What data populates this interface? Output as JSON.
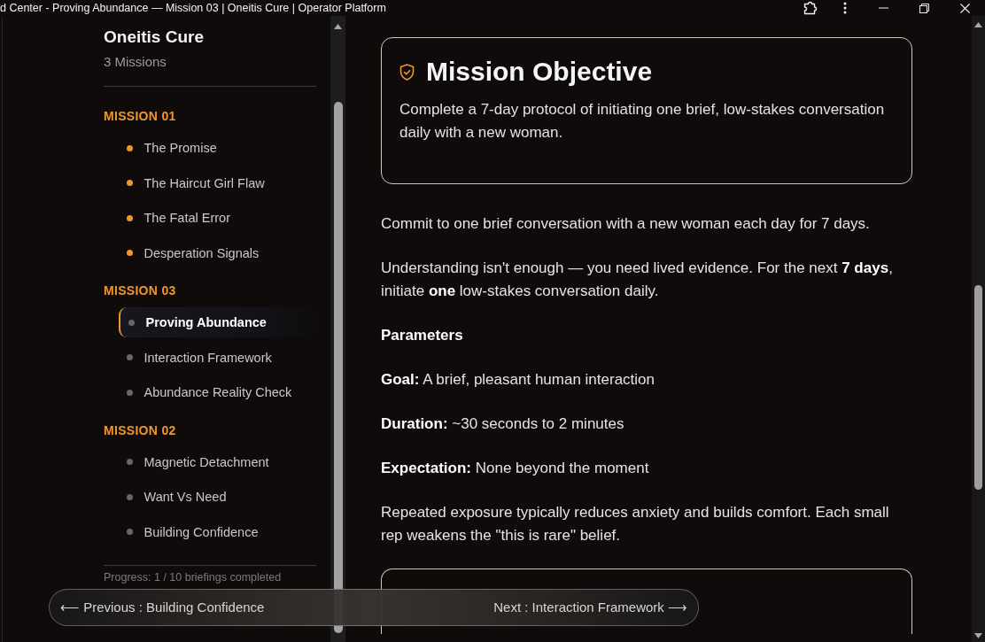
{
  "window": {
    "title": "d Center - Proving Abundance — Mission 03 | Oneitis Cure | Operator Platform"
  },
  "sidebar": {
    "title": "Oneitis Cure",
    "subtitle": "3 Missions",
    "missions": [
      {
        "label": "MISSION 01",
        "lessons": [
          {
            "label": "The Promise",
            "completed": true,
            "selected": false
          },
          {
            "label": "The Haircut Girl Flaw",
            "completed": true,
            "selected": false
          },
          {
            "label": "The Fatal Error",
            "completed": true,
            "selected": false
          },
          {
            "label": "Desperation Signals",
            "completed": true,
            "selected": false
          }
        ]
      },
      {
        "label": "MISSION 03",
        "lessons": [
          {
            "label": "Proving Abundance",
            "completed": false,
            "selected": true
          },
          {
            "label": "Interaction Framework",
            "completed": false,
            "selected": false
          },
          {
            "label": "Abundance Reality Check",
            "completed": false,
            "selected": false
          }
        ]
      },
      {
        "label": "MISSION 02",
        "lessons": [
          {
            "label": "Magnetic Detachment",
            "completed": false,
            "selected": false
          },
          {
            "label": "Want Vs Need",
            "completed": false,
            "selected": false
          },
          {
            "label": "Building Confidence",
            "completed": false,
            "selected": false
          }
        ]
      }
    ],
    "progress": "Progress: 1 / 10 briefings completed"
  },
  "objective": {
    "heading": "Mission Objective",
    "text": "Complete a 7-day protocol of initiating one brief, low-stakes conversation daily with a new woman."
  },
  "body": {
    "paragraphs": [
      {
        "kind": "text",
        "text": "Commit to one brief conversation with a new woman each day for 7 days."
      },
      {
        "kind": "text",
        "text": "Understanding isn't enough — you need lived evidence. For the next **7 days**, initiate **one** low-stakes conversation daily."
      },
      {
        "kind": "heading",
        "text": "Parameters"
      },
      {
        "kind": "text",
        "text": "**Goal:** A brief, pleasant human interaction"
      },
      {
        "kind": "text",
        "text": "**Duration:** ~30 seconds to 2 minutes"
      },
      {
        "kind": "text",
        "text": "**Expectation:** None beyond the moment"
      },
      {
        "kind": "text",
        "text": "Repeated exposure typically reduces anxiety and builds comfort. Each small rep weakens the \"this is rare\" belief."
      }
    ]
  },
  "navigation": {
    "previous": "⟵ Previous : Building Confidence",
    "next": "Next : Interaction Framework ⟶"
  }
}
